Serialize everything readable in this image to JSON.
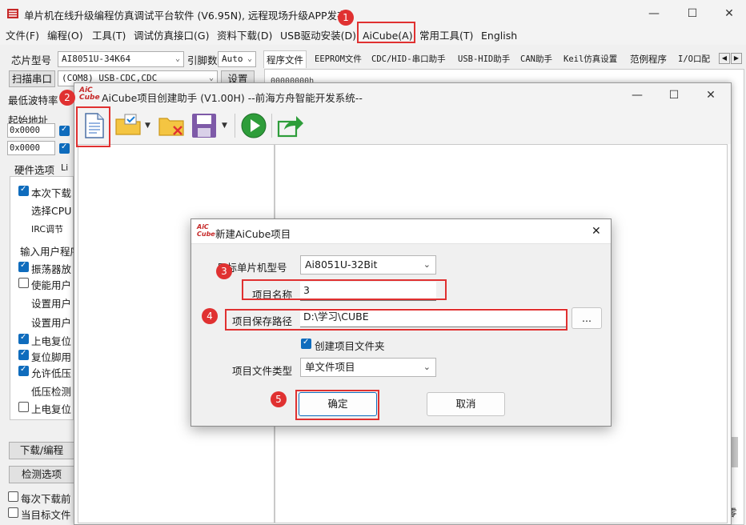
{
  "main_window": {
    "title": "单片机在线升级编程仿真调试平台软件 (V6.95N), 远程现场升级APP发布",
    "controls": {
      "minimize": "—",
      "maximize": "☐",
      "close": "✕"
    }
  },
  "menu": [
    "文件(F)",
    "编程(O)",
    "工具(T)",
    "调试仿真接口(G)",
    "资料下载(D)",
    "USB驱动安装(D)",
    "AiCube(A)",
    "常用工具(T)",
    "English"
  ],
  "left_panel": {
    "chip_label": "芯片型号",
    "chip_value": "AI8051U-34K64",
    "pin_label": "引脚数",
    "pin_value": "Auto",
    "scan_button": "扫描串口",
    "port_value": "(COM8) USB-CDC,CDC",
    "settings_button": "设置",
    "baud_label": "最低波特率",
    "start_addr_label": "起始地址",
    "addr1": "0x0000",
    "addr2": "0x0000",
    "tab_hw": "硬件选项",
    "tab_li": "Li",
    "options": [
      {
        "label": "本次下载",
        "checked": true
      },
      {
        "label": "选择CPU",
        "checked": null
      },
      {
        "label": "IRC调节",
        "checked": null
      },
      {
        "label": "输入用户程序",
        "checked": null
      },
      {
        "label": "振荡器放",
        "checked": true
      },
      {
        "label": "使能用户",
        "checked": false
      },
      {
        "label": "设置用户",
        "checked": null
      },
      {
        "label": "设置用户",
        "checked": null
      },
      {
        "label": "上电复位",
        "checked": true
      },
      {
        "label": "复位脚用",
        "checked": true
      },
      {
        "label": "允许低压",
        "checked": true
      },
      {
        "label": "低压检测",
        "checked": null
      },
      {
        "label": "上电复位",
        "checked": false
      }
    ],
    "download_button": "下载/编程",
    "check_button": "检测选项",
    "bottom_check1": "每次下载前",
    "bottom_check2": "当目标文件"
  },
  "right_tabs": [
    "程序文件",
    "EEPROM文件",
    "CDC/HID-串口助手",
    "USB-HID助手",
    "CAN助手",
    "Keil仿真设置",
    "范例程序",
    "I/O口配"
  ],
  "hex_preview": "00000000h",
  "corner_glyph": "零",
  "assistant": {
    "logo": "AiC Cube",
    "title": "AiCube项目创建助手 (V1.00H) --前海方舟智能开发系统--"
  },
  "dialog": {
    "title": "新建AiCube项目",
    "close": "✕",
    "target_label": "目标单片机型号",
    "target_value": "Ai8051U-32Bit",
    "name_label": "项目名称",
    "name_value": "3",
    "path_label": "项目保存路径",
    "path_value": "D:\\学习\\CUBE",
    "browse": "...",
    "create_folder_label": "创建项目文件夹",
    "create_folder_checked": true,
    "type_label": "项目文件类型",
    "type_value": "单文件项目",
    "ok": "确定",
    "cancel": "取消"
  },
  "annotations": [
    "1",
    "2",
    "3",
    "4",
    "5"
  ],
  "colors": {
    "highlight": "#e03131",
    "accent": "#0f6cbd",
    "run_green": "#2e9d3a"
  }
}
